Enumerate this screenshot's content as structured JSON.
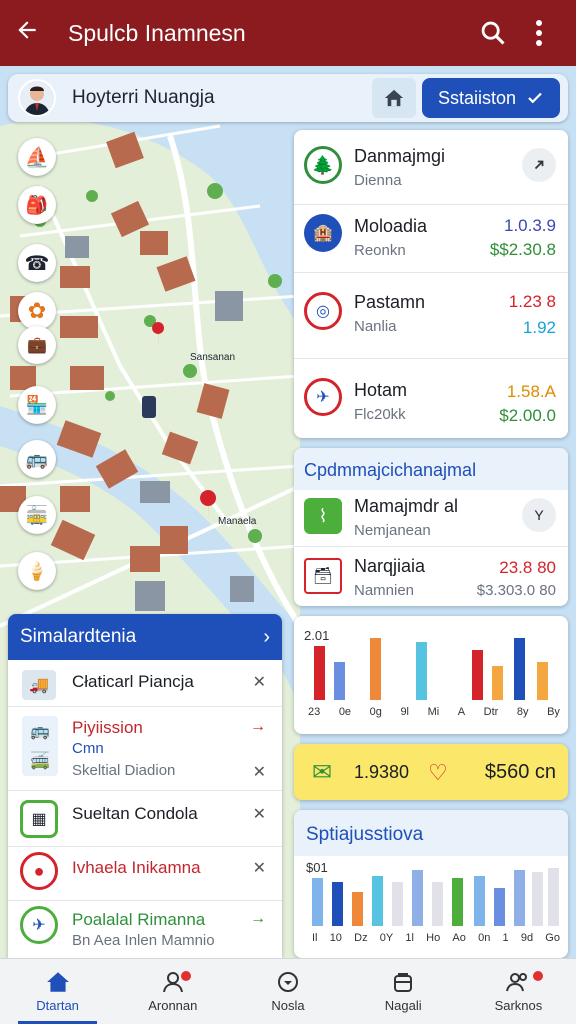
{
  "appbar": {
    "title": "Spulcb Inamnesn",
    "back_icon": "arrow-left-icon",
    "search_icon": "search-icon",
    "menu_icon": "more-vert-icon"
  },
  "user": {
    "name": "Hoyterri Nuangja",
    "status_label": "Sstaiiston"
  },
  "map": {
    "labels": [
      "Sansanan",
      "Manaela"
    ],
    "poi_icons": [
      "sailboat-icon",
      "backpack-icon",
      "chair-icon",
      "telephone-icon",
      "flower-icon",
      "bag-icon",
      "shop-icon",
      "bus-icon",
      "tram-icon",
      "ice-cream-icon"
    ]
  },
  "places": [
    {
      "title": "Danmajmgi",
      "sub": "Dienna"
    },
    {
      "title": "Moloadia",
      "sub": "Reonkn",
      "v1": "1.0.3.9",
      "v2": "$$2.30.8",
      "c1": "#3a48b0",
      "c2": "#2f8f3a"
    },
    {
      "title": "Pastamn",
      "sub": "Nanlia",
      "v1": "1.23 8",
      "v2": "1.92",
      "c1": "#d4232b",
      "c2": "#1aa0d8"
    },
    {
      "title": "Hotam",
      "sub": "Flc20kk",
      "v1": "1.58.A",
      "v2": "$2.00.0",
      "c1": "#e08a00",
      "c2": "#2f8f3a"
    }
  ],
  "summary": {
    "title": "Cpdmmajcichanajmal",
    "rows": [
      {
        "title": "Mamajmdr al",
        "sub": "Nemjanean"
      },
      {
        "title": "Narqjiaia",
        "sub": "Namnien",
        "v1": "23.8 80",
        "v2": "$3.303.0 80"
      }
    ]
  },
  "chart1": {
    "label": "2.01",
    "ticks": [
      "23",
      "0e",
      "0g",
      "9l",
      "Mi",
      "A",
      "Dtr",
      "8y",
      "By"
    ]
  },
  "total": {
    "left": "1.9380",
    "right": "$560 cn"
  },
  "chart2": {
    "title": "Sptiajusstiova",
    "label": "$01",
    "ticks": [
      "Il",
      "10",
      "Dz",
      "0Y",
      "1l",
      "Ho",
      "Ao",
      "0n",
      "1",
      "9d",
      "Go"
    ]
  },
  "transit": {
    "header": "Simalardtenia",
    "items": [
      {
        "title": "Cłaticarl Piancja"
      },
      {
        "title": "Piyiission",
        "sub": "Cmn",
        "sub2": "Skeltial Diadion"
      },
      {
        "title": "Sueltan Condola"
      },
      {
        "title": "Ivhaela Inikamna"
      },
      {
        "title": "Poalalal Rimanna",
        "sub": "Bn Aea Inlen Mamnio"
      }
    ]
  },
  "nav": [
    {
      "label": "Dtartan",
      "icon": "home-icon"
    },
    {
      "label": "Aronnan",
      "icon": "person-icon"
    },
    {
      "label": "Nosla",
      "icon": "compass-icon"
    },
    {
      "label": "Nagali",
      "icon": "bag-icon"
    },
    {
      "label": "Sarknos",
      "icon": "people-icon"
    }
  ],
  "colors": {
    "appbar": "#8b1b1f",
    "accent": "#1f4fb8",
    "map_water": "#c7e0f4",
    "total_bg": "#fbe86a"
  }
}
